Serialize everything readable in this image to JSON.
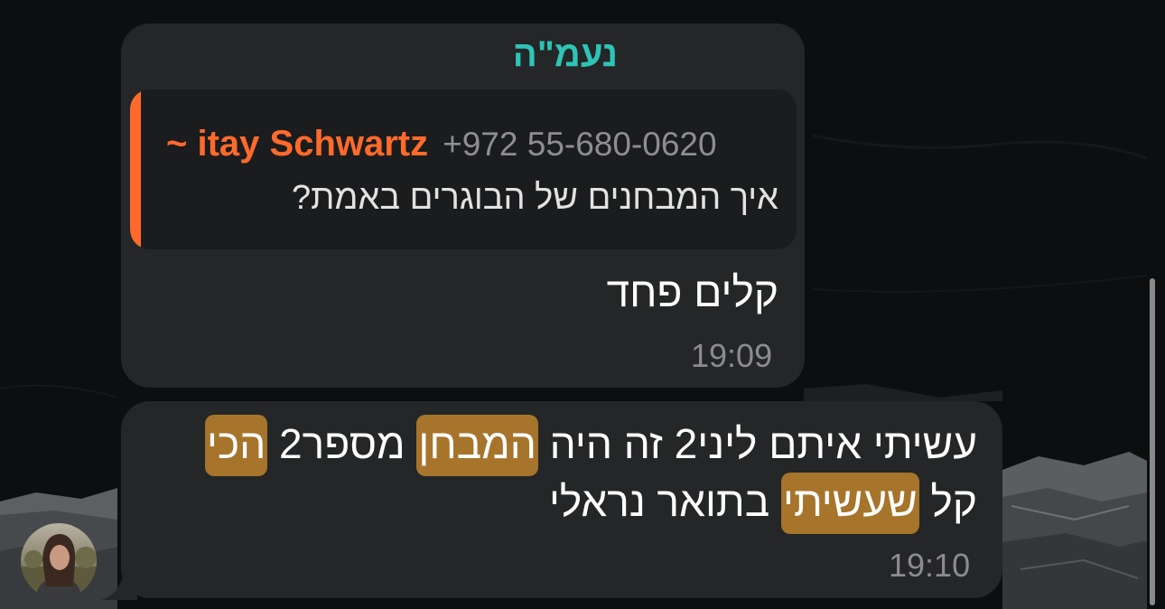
{
  "messages": [
    {
      "sender": "נעמ\"ה",
      "reply": {
        "name": "~ itay Schwartz",
        "phone": "+972 55-680-0620",
        "text": "איך המבחנים של הבוגרים באמת?"
      },
      "text": "קלים פחד",
      "time": "19:09"
    },
    {
      "line1": {
        "part1": "עשיתי איתם ליני2 זה היה ",
        "highlight1": "המבחן",
        "part2": " מספר2 ",
        "highlight2": "הכי"
      },
      "line2": {
        "part1": "קל ",
        "highlight": "שעשיתי",
        "part2": " בתואר נראלי"
      },
      "time": "19:10"
    }
  ],
  "colors": {
    "bubble": "#242627",
    "sender": "#2ec4b6",
    "reply_accent": "#ff6a2c",
    "search_highlight": "#a6742b",
    "background": "#0d0f11"
  },
  "icons": {
    "avatar": "avatar-photo"
  }
}
